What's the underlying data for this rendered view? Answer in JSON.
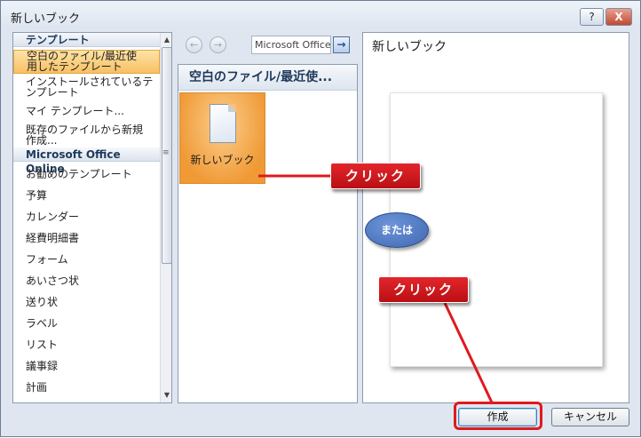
{
  "window": {
    "title": "新しいブック",
    "help_label": "?",
    "close_label": "X"
  },
  "sidebar": {
    "header_templates": "テンプレート",
    "items_top": [
      "空白のファイル/最近使\n用したテンプレート",
      "インストールされているテ\nンプレート",
      "マイ テンプレート...",
      "既存のファイルから新規\n作成..."
    ],
    "header_online": "Microsoft Office Online",
    "items_online": [
      "お勧めのテンプレート",
      "予算",
      "カレンダー",
      "経費明細書",
      "フォーム",
      "あいさつ状",
      "送り状",
      "ラベル",
      "リスト",
      "議事録",
      "計画"
    ],
    "selected_index": 0
  },
  "navbar": {
    "search_value": "Microsoft Office",
    "back_icon": "←",
    "forward_icon": "→",
    "go_icon": "→"
  },
  "middle": {
    "header": "空白のファイル/最近使...",
    "tile_label": "新しいブック"
  },
  "right": {
    "title": "新しいブック"
  },
  "buttons": {
    "create": "作成",
    "cancel": "キャンセル"
  },
  "annotations": {
    "click_1": "クリック",
    "or": "または",
    "click_2": "クリック",
    "color_red": "#e0191e",
    "color_blue": "#3f68b3"
  }
}
